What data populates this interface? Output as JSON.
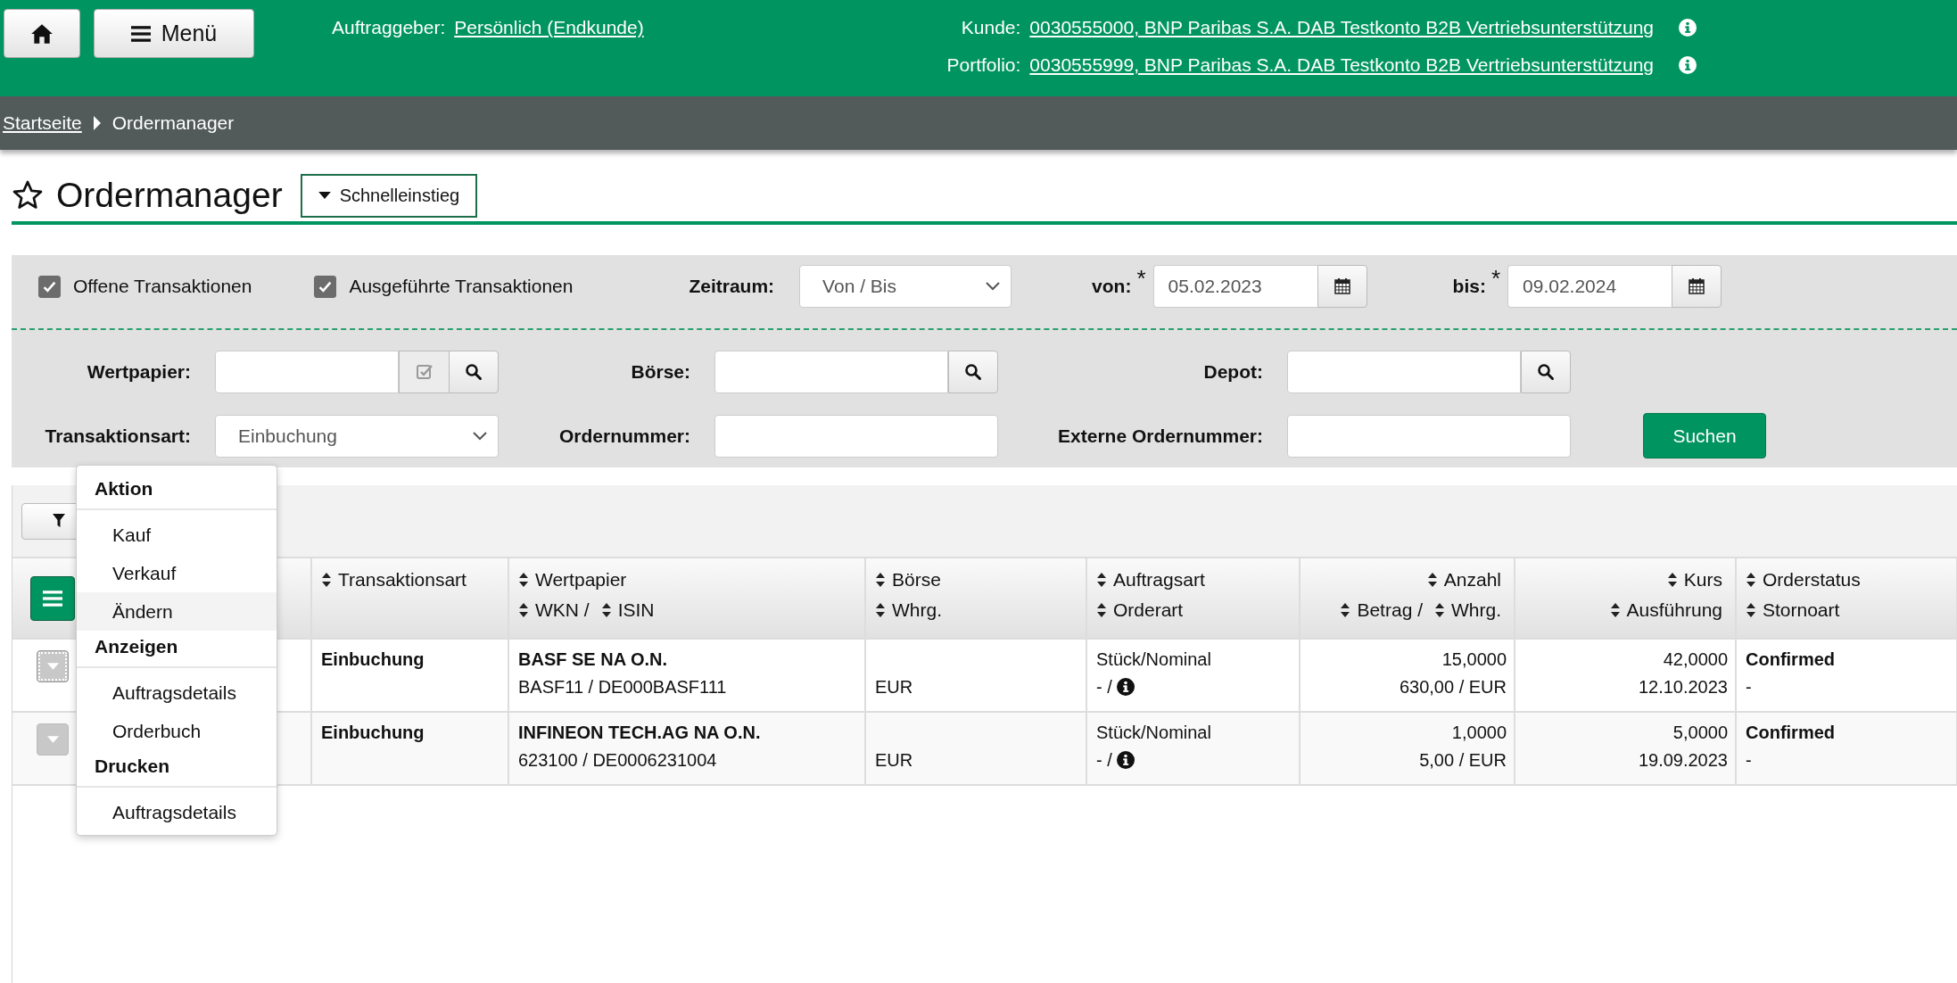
{
  "header": {
    "menu_button": "Menü",
    "client": {
      "label": "Auftraggeber:",
      "value": "Persönlich (Endkunde)"
    },
    "accounts": [
      {
        "label": "Kunde:",
        "value": "0030555000, BNP Paribas S.A. DAB Testkonto B2B Vertriebsunterstützung"
      },
      {
        "label": "Portfolio:",
        "value": "0030555999, BNP Paribas S.A. DAB Testkonto B2B Vertriebsunterstützung"
      }
    ]
  },
  "breadcrumb": [
    {
      "label": "Startseite",
      "kind": "link"
    },
    {
      "label": "Ordermanager",
      "kind": "current"
    }
  ],
  "page_title": "Ordermanager",
  "quick_access": "Schnelleinstieg",
  "filters": {
    "checkboxes": [
      {
        "label": "Offene Transaktionen",
        "checked": true
      },
      {
        "label": "Ausgeführte Transaktionen",
        "checked": true
      }
    ],
    "period": {
      "label": "Zeitraum:",
      "value": "Von / Bis"
    },
    "dates": [
      {
        "label": "von:",
        "required_mark": "*",
        "value": "05.02.2023"
      },
      {
        "label": "bis:",
        "required_mark": "*",
        "value": "09.02.2024"
      }
    ],
    "fields": [
      [
        {
          "label": "Wertpapier:",
          "kind": "lookup"
        },
        {
          "label": "Börse:",
          "kind": "search"
        },
        {
          "label": "Depot:",
          "kind": "search"
        }
      ],
      [
        {
          "label": "Transaktionsart:",
          "kind": "select",
          "value": "Einbuchung"
        },
        {
          "label": "Ordernummer:",
          "kind": "text"
        },
        {
          "label": "Externe Ordernummer:",
          "kind": "text"
        }
      ]
    ],
    "search_button": "Suchen"
  },
  "table": {
    "columns": [
      {
        "kind": "text",
        "lines": [
          [
            "Transaktionsart"
          ]
        ]
      },
      {
        "kind": "text",
        "lines": [
          [
            "Wertpapier"
          ],
          [
            "WKN /",
            "ISIN"
          ]
        ]
      },
      {
        "kind": "text",
        "lines": [
          [
            "Börse"
          ],
          [
            "Whrg."
          ]
        ]
      },
      {
        "kind": "text",
        "lines": [
          [
            "Auftragsart"
          ],
          [
            "Orderart"
          ]
        ]
      },
      {
        "kind": "number",
        "lines": [
          [
            "Anzahl"
          ],
          [
            "Betrag /",
            "Whrg."
          ]
        ]
      },
      {
        "kind": "number",
        "lines": [
          [
            "Kurs"
          ],
          [
            "Ausführung"
          ]
        ]
      },
      {
        "kind": "text",
        "lines": [
          [
            "Orderstatus"
          ],
          [
            "Stornoart"
          ]
        ]
      }
    ],
    "rows": [
      {
        "menu_open": true,
        "cells": [
          {
            "line1": "Einbuchung",
            "bold": true
          },
          {
            "line1": "BASF SE NA O.N.",
            "line2": "BASF11 / DE000BASF111",
            "bold": true
          },
          {
            "line2": "EUR"
          },
          {
            "line1": "Stück/Nominal",
            "line2": "- /",
            "info": true
          },
          {
            "line1": "15,0000",
            "line2": "630,00 / EUR"
          },
          {
            "line1": "42,0000",
            "line2": "12.10.2023"
          },
          {
            "line1": "Confirmed",
            "line2": "-",
            "bold": true
          }
        ]
      },
      {
        "menu_open": false,
        "cells": [
          {
            "line1": "Einbuchung",
            "bold": true
          },
          {
            "line1": "INFINEON TECH.AG NA O.N.",
            "line2": "623100 / DE0006231004",
            "bold": true
          },
          {
            "line2": "EUR"
          },
          {
            "line1": "Stück/Nominal",
            "line2": "- /",
            "info": true
          },
          {
            "line1": "1,0000",
            "line2": "5,00 / EUR"
          },
          {
            "line1": "5,0000",
            "line2": "19.09.2023"
          },
          {
            "line1": "Confirmed",
            "line2": "-",
            "bold": true
          }
        ]
      }
    ]
  },
  "action_menu": {
    "sections": [
      {
        "title": "Aktion",
        "items": [
          {
            "label": "Kauf",
            "selected": false
          },
          {
            "label": "Verkauf",
            "selected": false
          },
          {
            "label": "Ändern",
            "selected": true
          }
        ]
      },
      {
        "title": "Anzeigen",
        "items": [
          {
            "label": "Auftragsdetails",
            "selected": false
          },
          {
            "label": "Orderbuch",
            "selected": false
          }
        ]
      },
      {
        "title": "Drucken",
        "items": [
          {
            "label": "Auftragsdetails",
            "selected": false
          }
        ]
      }
    ]
  }
}
